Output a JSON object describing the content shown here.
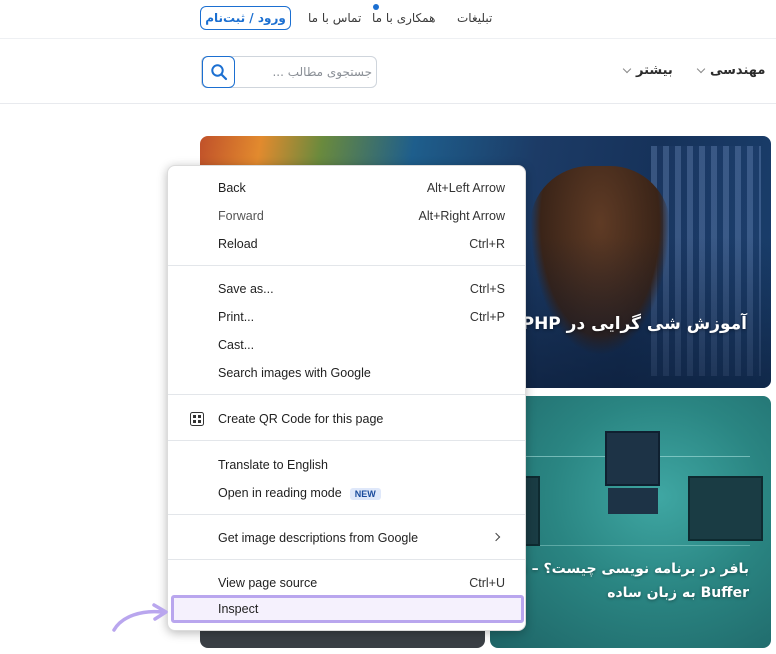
{
  "topbar": {
    "login_label": "ورود / ثبت‌نام",
    "links": [
      "تماس با ما",
      "همکاری با ما",
      "تبلیغات"
    ]
  },
  "header": {
    "search_placeholder": "جستجوی مطالب ...",
    "nav": [
      {
        "label": "مهندسی"
      },
      {
        "label": "بیشتر"
      }
    ]
  },
  "cards": [
    {
      "title": "آموزش شی گرایی در PHP به"
    },
    {
      "title_line1": "بافر در برنامه نویسی چیست؟ – توضی",
      "title_line2": "Buffer به زبان ساده"
    }
  ],
  "context_menu": {
    "items": [
      {
        "label": "Back",
        "shortcut": "Alt+Left Arrow"
      },
      {
        "label": "Forward",
        "shortcut": "Alt+Right Arrow"
      },
      {
        "label": "Reload",
        "shortcut": "Ctrl+R"
      },
      {
        "label": "Save as...",
        "shortcut": "Ctrl+S"
      },
      {
        "label": "Print...",
        "shortcut": "Ctrl+P"
      },
      {
        "label": "Cast..."
      },
      {
        "label": "Search images with Google"
      },
      {
        "label": "Create QR Code for this page"
      },
      {
        "label": "Translate to English"
      },
      {
        "label": "Open in reading mode",
        "badge": "NEW"
      },
      {
        "label": "Get image descriptions from Google"
      },
      {
        "label": "View page source",
        "shortcut": "Ctrl+U"
      },
      {
        "label": "Inspect"
      }
    ]
  },
  "colors": {
    "accent": "#1b6fd1",
    "highlight": "#b9a6ee"
  }
}
